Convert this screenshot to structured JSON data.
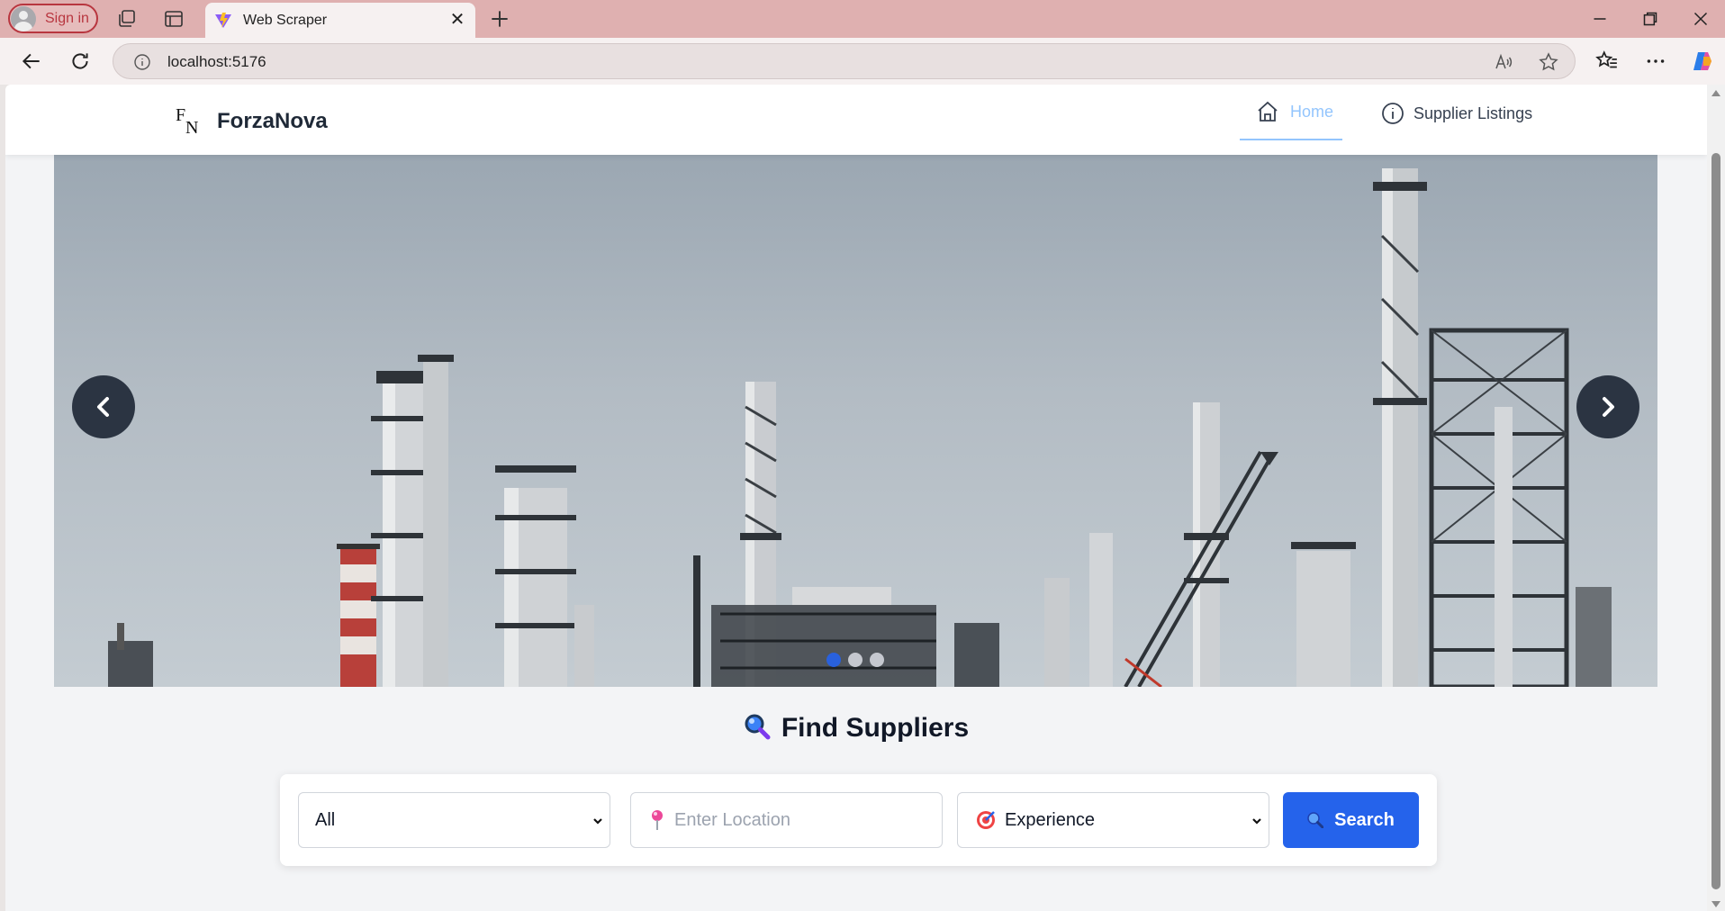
{
  "browser": {
    "signin_label": "Sign in",
    "tab_title": "Web Scraper",
    "url": "localhost:5176"
  },
  "site": {
    "logo_text": "ForzaNova",
    "nav": {
      "home": "Home",
      "supplier_listings": "Supplier Listings"
    }
  },
  "hero": {
    "slide_count": 3,
    "active_slide": 1
  },
  "search": {
    "title": "Find Suppliers",
    "category_value": "All",
    "location_placeholder": "Enter Location",
    "experience_value": "Experience",
    "button_label": "Search"
  },
  "colors": {
    "accent": "#2563eb",
    "nav_active": "#93c5fd",
    "titlebar": "#dfb0b0"
  }
}
